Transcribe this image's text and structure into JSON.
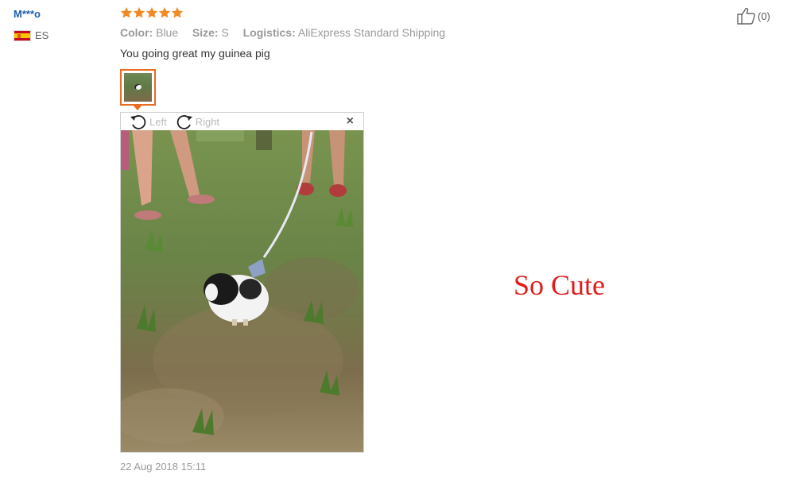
{
  "review": {
    "user_name": "M***o",
    "country_code": "ES",
    "rating": 5,
    "color_label": "Color:",
    "color_value": "Blue",
    "size_label": "Size:",
    "size_value": "S",
    "logistics_label": "Logistics:",
    "logistics_value": "AliExpress Standard Shipping",
    "text": "You going great my guinea pig",
    "date": "22 Aug 2018 15:11",
    "likes": "(0)"
  },
  "viewer": {
    "rotate_left_label": "Left",
    "rotate_right_label": "Right",
    "close_symbol": "×"
  },
  "annotation": "So Cute",
  "colors": {
    "username": "#1c5eab",
    "star": "#f08a24",
    "thumb_border": "#e96c1f",
    "annotation": "#e01b1b"
  },
  "icons": [
    "star-icon",
    "spain-flag-icon",
    "rotate-left-icon",
    "rotate-right-icon",
    "close-icon",
    "thumbs-up-icon"
  ]
}
